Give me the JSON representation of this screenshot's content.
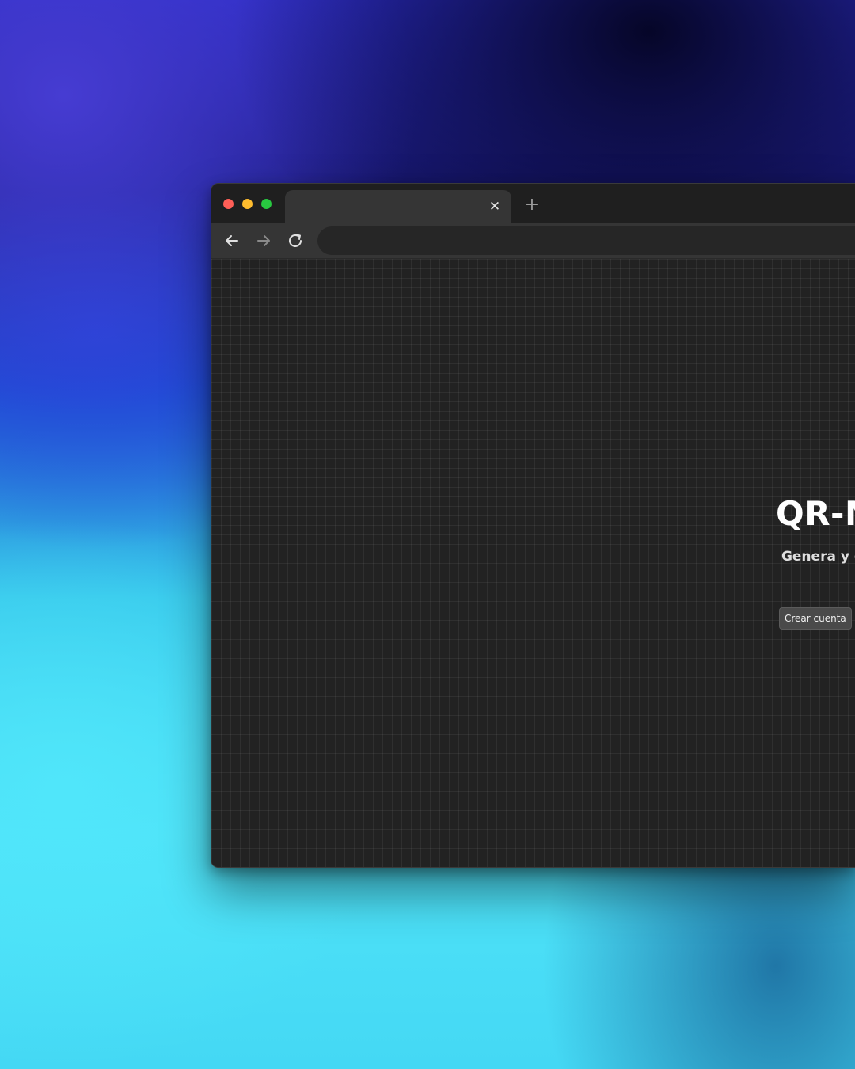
{
  "browser": {
    "traffic_lights": {
      "close_color": "#ff5f57",
      "minimize_color": "#febc2e",
      "maximize_color": "#28c840"
    },
    "tab": {
      "title": "",
      "close_icon": "close-icon"
    },
    "new_tab_icon": "plus-icon",
    "toolbar": {
      "back_icon": "arrow-left-icon",
      "forward_icon": "arrow-right-icon",
      "reload_icon": "reload-icon",
      "address": ""
    }
  },
  "page": {
    "hero": {
      "title": "QR-N",
      "subtitle": "Genera y guarc QR fácil",
      "cta_label": "Crear cuenta"
    }
  },
  "colors": {
    "window_bg": "#222222",
    "titlebar_bg": "#1f1f1f",
    "toolbar_bg": "#353535",
    "address_bar_bg": "#262626",
    "cta_bg": "#4a4a4a"
  }
}
